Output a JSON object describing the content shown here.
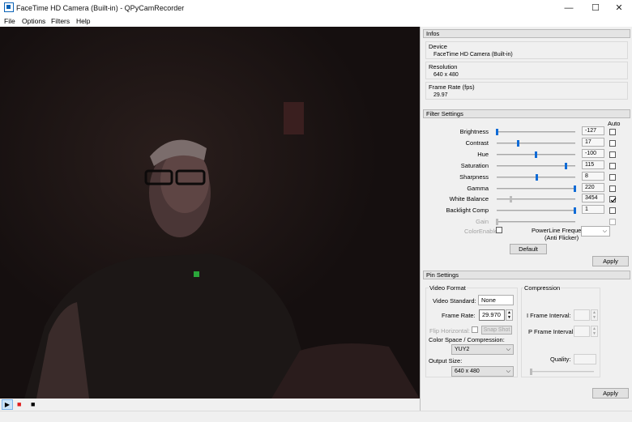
{
  "window": {
    "title": "FaceTime HD Camera (Built-in) - QPyCamRecorder",
    "controls": {
      "minimize": "—",
      "maximize": "☐",
      "close": "✕"
    }
  },
  "menu": [
    "File",
    "Options",
    "Filters",
    "Help"
  ],
  "playback": {
    "play": "▶",
    "record": "■",
    "stop": "■",
    "record_color": "#e01b1b"
  },
  "infos": {
    "title": "Infos",
    "device_label": "Device",
    "device_value": "FaceTime HD Camera (Built-in)",
    "resolution_label": "Resolution",
    "resolution_value": "640 x 480",
    "framerate_label": "Frame Rate (fps)",
    "framerate_value": "29.97"
  },
  "filter_settings": {
    "title": "Filter Settings",
    "auto_label": "Auto",
    "rows": [
      {
        "label": "Brightness",
        "value": "-127",
        "slider": 0.0,
        "auto": false
      },
      {
        "label": "Contrast",
        "value": "17",
        "slider": 0.27,
        "auto": false
      },
      {
        "label": "Hue",
        "value": "-100",
        "slider": 0.49,
        "auto": false
      },
      {
        "label": "Saturation",
        "value": "115",
        "slider": 0.88,
        "auto": false
      },
      {
        "label": "Sharpness",
        "value": "8",
        "slider": 0.5,
        "auto": false
      },
      {
        "label": "Gamma",
        "value": "220",
        "slider": 0.99,
        "auto": false
      },
      {
        "label": "White Balance",
        "value": "3454",
        "slider": 0.18,
        "auto": true
      },
      {
        "label": "Backlight Comp",
        "value": "1",
        "slider": 0.99,
        "auto": false
      },
      {
        "label": "Gain",
        "value": "",
        "slider": 0.0,
        "auto": false
      }
    ],
    "color_enable_label": "ColorEnable",
    "powerline_label": "PowerLine Frequency",
    "powerline_sub": "(Anti Flicker)",
    "default_button": "Default",
    "apply_button": "Apply"
  },
  "pin_settings": {
    "title": "Pin Settings",
    "video_format_label": "Video Format",
    "video_standard_label": "Video Standard:",
    "video_standard_value": "None",
    "frame_rate_label": "Frame Rate:",
    "frame_rate_value": "29.970",
    "flip_horizontal_label": "Flip Horizontal:",
    "snap_shot_button": "Snap Shot",
    "color_space_label": "Color Space / Compression:",
    "color_space_value": "YUY2",
    "output_size_label": "Output Size:",
    "output_size_value": "640 x 480",
    "compression_label": "Compression",
    "i_frame_label": "I Frame Interval:",
    "p_frame_label": "P Frame Interval:",
    "quality_label": "Quality:",
    "apply_button": "Apply"
  }
}
